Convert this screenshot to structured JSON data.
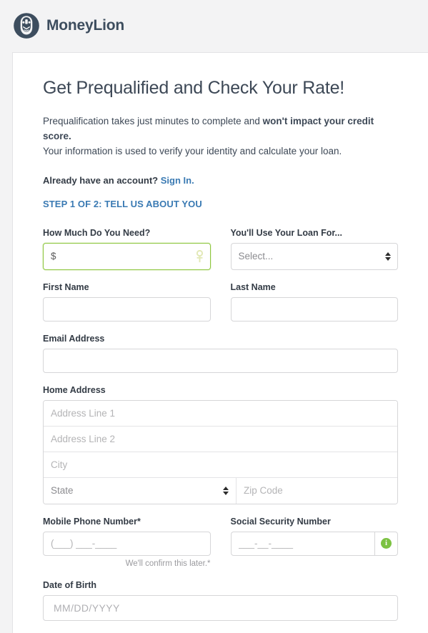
{
  "brand": {
    "name": "MoneyLion",
    "logo_icon": "lion-head-icon",
    "logo_color": "#3d4d5e"
  },
  "page": {
    "title": "Get Prequalified and Check Your Rate!",
    "lede_part1": "Prequalification takes just minutes to complete and ",
    "lede_bold": "won't impact your credit score.",
    "lede_part2": "Your information is used to verify your identity and calculate your loan.",
    "account_prompt": "Already have an account?",
    "signin_label": "Sign In.",
    "step_label": "STEP 1 OF 2: TELL US ABOUT YOU",
    "accent_link_color": "#3a7ab3",
    "accent_green": "#8ec63f"
  },
  "form": {
    "amount": {
      "label": "How Much Do You Need?",
      "value": "$",
      "placeholder": "$",
      "focused": true,
      "key_icon": "key-icon"
    },
    "loan_purpose": {
      "label": "You'll Use Your Loan For...",
      "selected": "Select...",
      "options": [
        "Select..."
      ]
    },
    "first_name": {
      "label": "First Name",
      "value": "",
      "placeholder": ""
    },
    "last_name": {
      "label": "Last Name",
      "value": "",
      "placeholder": ""
    },
    "email": {
      "label": "Email Address",
      "value": "",
      "placeholder": ""
    },
    "home_address": {
      "label": "Home Address",
      "line1_placeholder": "Address Line 1",
      "line2_placeholder": "Address Line 2",
      "city_placeholder": "City",
      "state_selected": "State",
      "state_options": [
        "State"
      ],
      "zip_placeholder": "Zip Code"
    },
    "mobile_phone": {
      "label": "Mobile Phone Number*",
      "placeholder": "(___) ___-____",
      "helper": "We'll confirm this later.*"
    },
    "ssn": {
      "label": "Social Security Number",
      "placeholder": "___-__-____",
      "info_icon": "info-circle-icon",
      "info_icon_color": "#7cc242"
    },
    "date_of_birth": {
      "label": "Date of Birth",
      "placeholder": "MM/DD/YYYY"
    }
  }
}
